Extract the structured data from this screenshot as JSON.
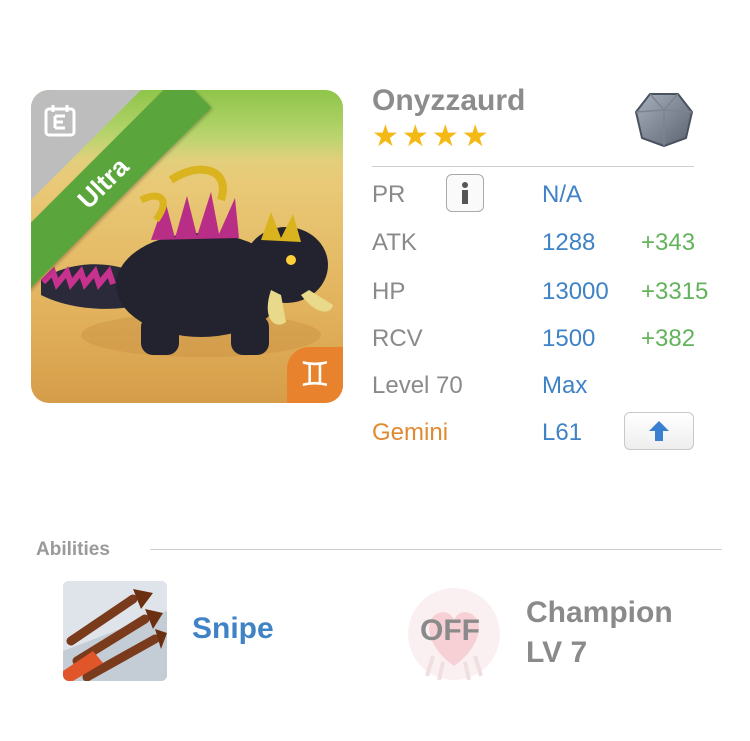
{
  "monster": {
    "name": "Onyzzaurd",
    "rarity_label": "Ultra",
    "star_count": 4,
    "stars": [
      "★",
      "★",
      "★",
      "★"
    ],
    "zodiac_symbol": "♊",
    "element_icon": "rock-gem-icon",
    "colors": {
      "rarity": "#5aa63d",
      "zodiac": "#e8822c",
      "stars": "#f5b916",
      "value": "#3f82c6",
      "bonus": "#63b35b"
    }
  },
  "stats": {
    "pr": {
      "label": "PR",
      "value": "N/A"
    },
    "atk": {
      "label": "ATK",
      "value": "1288",
      "bonus": "+343"
    },
    "hp": {
      "label": "HP",
      "value": "13000",
      "bonus": "+3315"
    },
    "rcv": {
      "label": "RCV",
      "value": "1500",
      "bonus": "+382"
    },
    "level": {
      "label": "Level 70",
      "value": "Max"
    },
    "zodiac": {
      "label": "Gemini",
      "value": "L61"
    }
  },
  "abilities": {
    "section_label": "Abilities",
    "primary": {
      "name": "Snipe",
      "icon": "arrows-icon"
    },
    "champion": {
      "status": "OFF",
      "title": "Champion",
      "level": "LV 7",
      "icon": "heart-badge-icon"
    }
  }
}
